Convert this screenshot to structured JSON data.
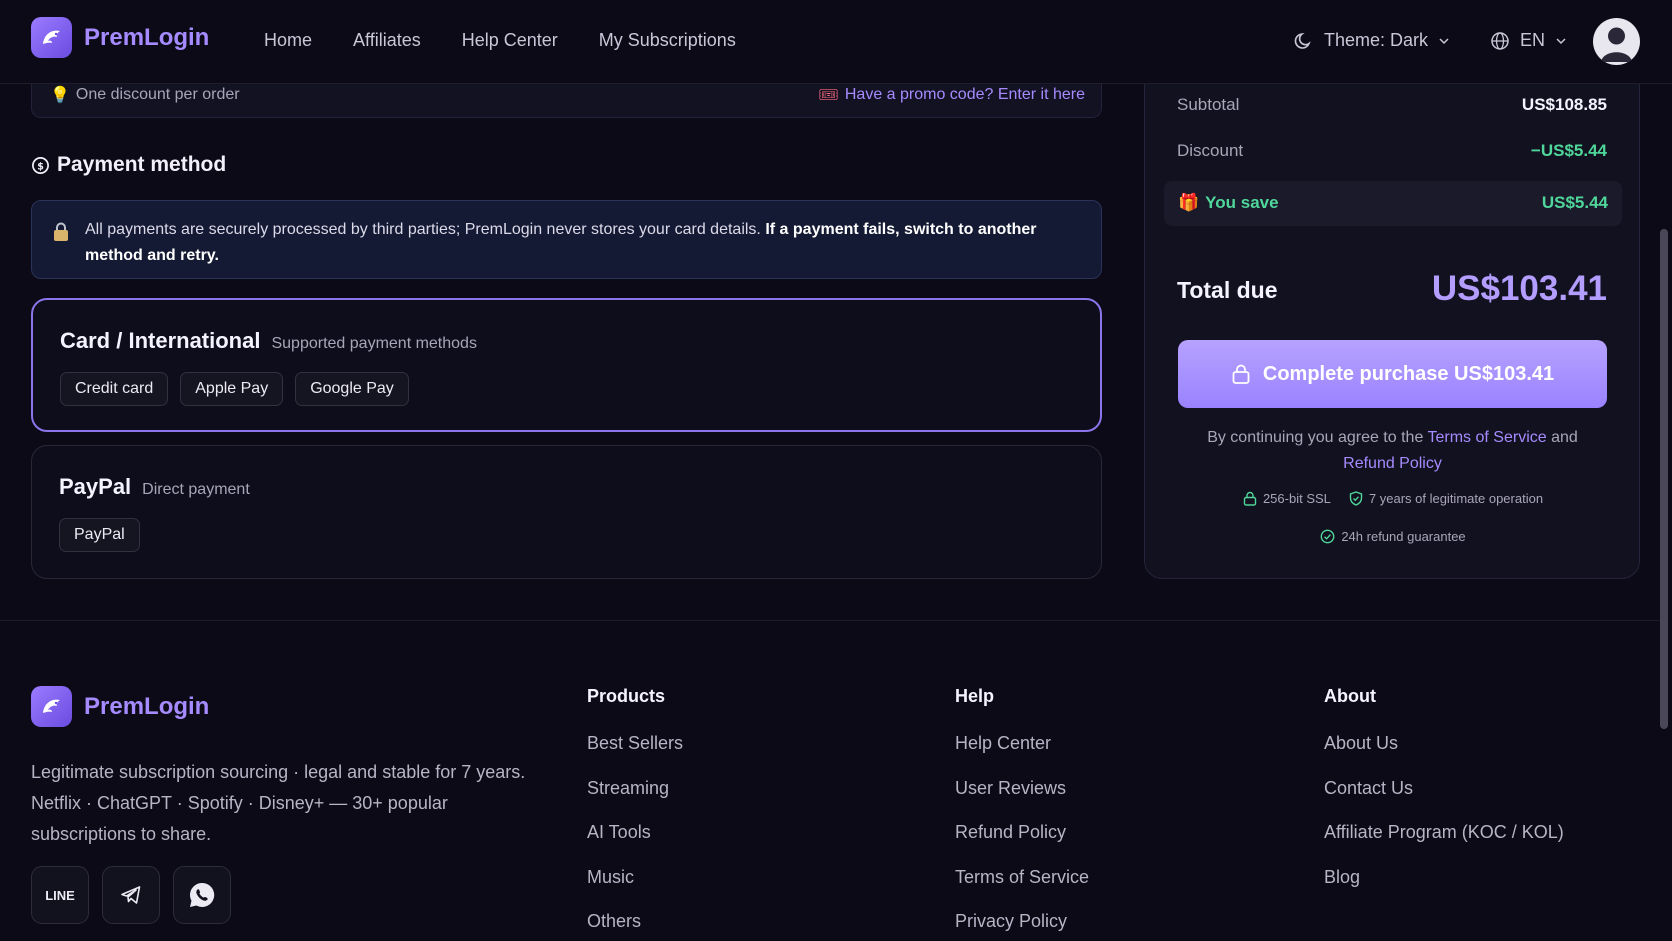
{
  "brand": {
    "name": "PremLogin"
  },
  "nav": {
    "items": [
      "Home",
      "Affiliates",
      "Help Center",
      "My Subscriptions"
    ],
    "theme_label": "Theme: Dark",
    "lang_label": "EN"
  },
  "promo": {
    "note": "One discount per order",
    "link": "Have a promo code? Enter it here"
  },
  "payment": {
    "title": "Payment method",
    "notice_text": "All payments are securely processed by third parties; PremLogin never stores your card details.",
    "notice_bold": "If a payment fails, switch to another method and retry.",
    "methods": [
      {
        "name": "Card / International",
        "subtitle": "Supported payment methods",
        "options": [
          "Credit card",
          "Apple Pay",
          "Google Pay"
        ],
        "selected": true
      },
      {
        "name": "PayPal",
        "subtitle": "Direct payment",
        "options": [
          "PayPal"
        ],
        "selected": false
      }
    ]
  },
  "summary": {
    "subtotal_label": "Subtotal",
    "subtotal_value": "US$108.85",
    "discount_label": "Discount",
    "discount_value": "−US$5.44",
    "save_label": "You save",
    "save_value": "US$5.44",
    "total_label": "Total due",
    "total_value": "US$103.41",
    "cta_label": "Complete purchase US$103.41",
    "terms_prefix": "By continuing you agree to the",
    "terms_link": "Terms of Service",
    "terms_and": "and",
    "refund_link": "Refund Policy",
    "badge_ssl": "256-bit SSL",
    "badge_years": "7 years of legitimate operation",
    "badge_refund": "24h refund guarantee"
  },
  "footer": {
    "description": "Legitimate subscription sourcing · legal and stable for 7 years. Netflix · ChatGPT · Spotify · Disney+ — 30+ popular subscriptions to share.",
    "social_line": "LINE",
    "columns": [
      {
        "title": "Products",
        "links": [
          "Best Sellers",
          "Streaming",
          "AI Tools",
          "Music",
          "Others"
        ]
      },
      {
        "title": "Help",
        "links": [
          "Help Center",
          "User Reviews",
          "Refund Policy",
          "Terms of Service",
          "Privacy Policy"
        ]
      },
      {
        "title": "About",
        "links": [
          "About Us",
          "Contact Us",
          "Affiliate Program (KOC / KOL)",
          "Blog"
        ]
      }
    ]
  },
  "colors": {
    "accent": "#a58bff",
    "success": "#4fd69a",
    "background": "#0b0a16"
  }
}
